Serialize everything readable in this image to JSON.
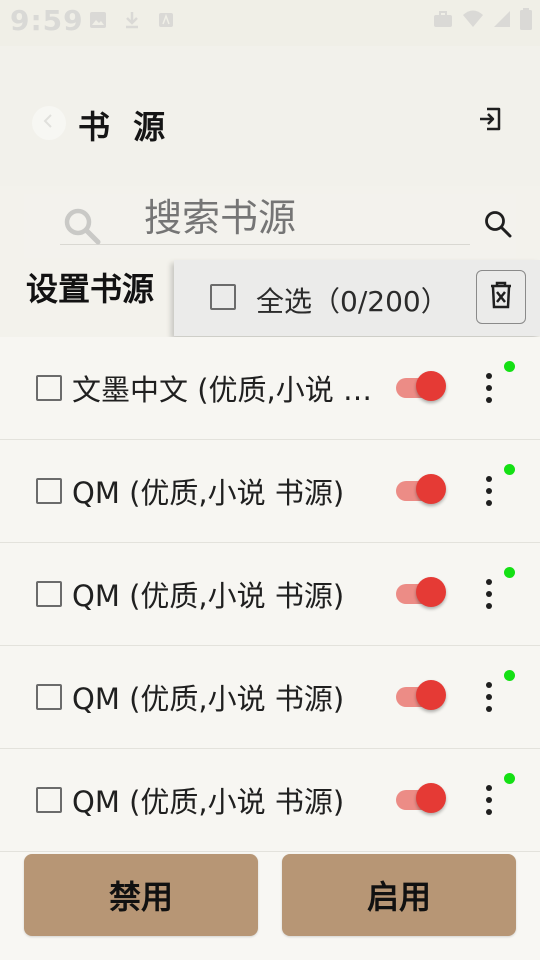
{
  "status_bar": {
    "time": "9:59",
    "left_icons": [
      "image-icon",
      "download-icon",
      "font-icon"
    ],
    "right_icons": [
      "briefcase-icon",
      "wifi-icon",
      "signal-icon",
      "battery-icon"
    ]
  },
  "header": {
    "title": "书 源",
    "back_icon": "chevron-left-icon",
    "import_icon": "import-icon"
  },
  "search": {
    "placeholder": "搜索书源",
    "icon": "search-icon"
  },
  "section": {
    "title": "设置书源"
  },
  "selection": {
    "select_all_label": "全选（0/200）",
    "delete_icon": "delete-icon"
  },
  "sources": [
    {
      "name": "文墨中文 (优质,小说 书源)",
      "enabled": true,
      "online": true
    },
    {
      "name": "QM (优质,小说 书源)",
      "enabled": true,
      "online": true
    },
    {
      "name": "QM (优质,小说 书源)",
      "enabled": true,
      "online": true
    },
    {
      "name": "QM (优质,小说 书源)",
      "enabled": true,
      "online": true
    },
    {
      "name": "QM (优质,小说 书源)",
      "enabled": true,
      "online": true
    }
  ],
  "actions": {
    "disable_label": "禁用",
    "enable_label": "启用"
  },
  "colors": {
    "toggle_on": "#e53a35",
    "online": "#14e014",
    "action_button": "#b79675"
  }
}
